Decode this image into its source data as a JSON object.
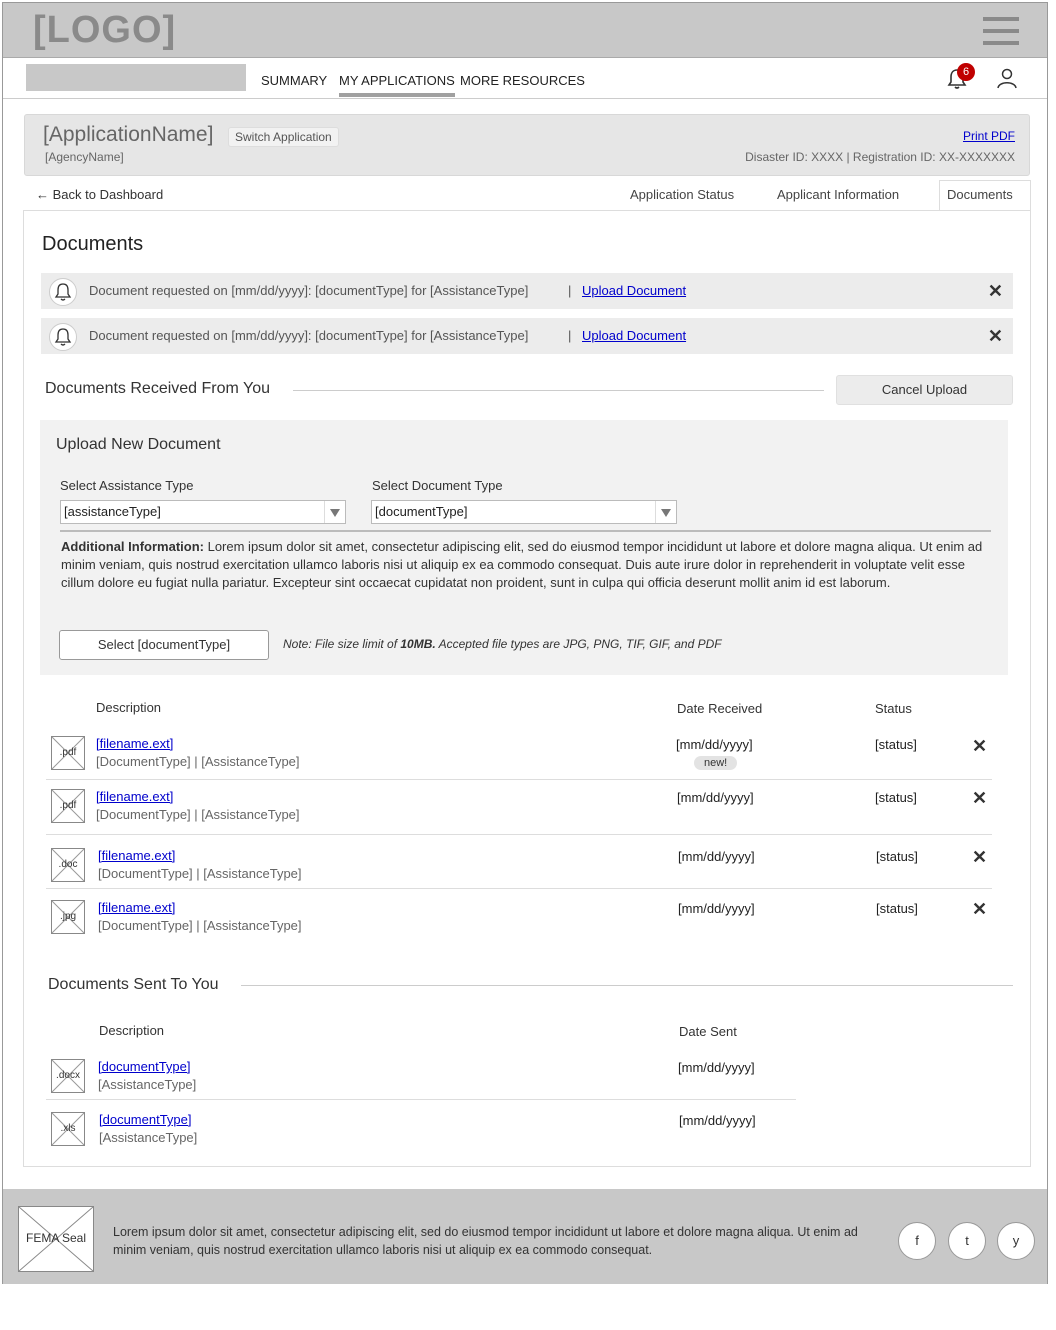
{
  "header": {
    "logo": "[LOGO]",
    "nav": [
      "SUMMARY",
      "MY APPLICATIONS",
      "MORE RESOURCES"
    ],
    "notification_count": "6"
  },
  "app": {
    "name": "[ApplicationName]",
    "switch_label": "Switch Application",
    "agency": "[AgencyName]",
    "print_label": "Print PDF",
    "ids": "Disaster ID: XXXX | Registration ID: XX-XXXXXXX"
  },
  "tabs": {
    "back": "← Back to Dashboard",
    "items": [
      "Application Status",
      "Applicant Information",
      "Documents"
    ],
    "active": "Documents"
  },
  "documents": {
    "title": "Documents",
    "notices": [
      {
        "text": "Document requested on [mm/dd/yyyy]: [documentType] for [AssistanceType]",
        "link": "Upload Document"
      },
      {
        "text": "Document requested on [mm/dd/yyyy]: [documentType] for [AssistanceType]",
        "link": "Upload Document"
      }
    ],
    "received_title": "Documents Received From You",
    "cancel_label": "Cancel Upload",
    "upload": {
      "title": "Upload New Document",
      "assistance_label": "Select Assistance Type",
      "assistance_value": "[assistanceType]",
      "doctype_label": "Select Document Type",
      "doctype_value": "[documentType]",
      "info_label": "Additional Information:",
      "info_text": " Lorem ipsum dolor sit amet, consectetur adipiscing elit, sed do eiusmod tempor incididunt ut labore et dolore magna aliqua. Ut enim ad minim veniam, quis nostrud exercitation ullamco laboris nisi ut aliquip ex ea commodo consequat. Duis aute irure dolor in reprehenderit in voluptate velit esse cillum dolore eu fugiat nulla pariatur. Excepteur sint occaecat cupidatat non proident, sunt in culpa qui officia deserunt mollit anim id est laborum.",
      "select_button": "Select [documentType]",
      "note_prefix": "Note: File size limit of ",
      "note_limit": "10MB.",
      "note_suffix": " Accepted file types are  JPG, PNG, TIF, GIF, and PDF"
    },
    "received_columns": [
      "Description",
      "Date Received",
      "Status"
    ],
    "received_rows": [
      {
        "ext": ".pdf",
        "name": "[filename.ext]",
        "meta": "[DocumentType] | [AssistanceType]",
        "date": "[mm/dd/yyyy]",
        "status": "[status]",
        "badge": "new!"
      },
      {
        "ext": ".pdf",
        "name": "[filename.ext]",
        "meta": "[DocumentType] | [AssistanceType]",
        "date": "[mm/dd/yyyy]",
        "status": "[status]"
      },
      {
        "ext": ".doc",
        "name": "[filename.ext]",
        "meta": "[DocumentType] | [AssistanceType]",
        "date": "[mm/dd/yyyy]",
        "status": "[status]"
      },
      {
        "ext": ".jpg",
        "name": "[filename.ext]",
        "meta": "[DocumentType] | [AssistanceType]",
        "date": "[mm/dd/yyyy]",
        "status": "[status]"
      }
    ],
    "sent_title": "Documents Sent To You",
    "sent_columns": [
      "Description",
      "Date Sent"
    ],
    "sent_rows": [
      {
        "ext": ".docx",
        "name": "[documentType]",
        "meta": "[AssistanceType]",
        "date": "[mm/dd/yyyy]"
      },
      {
        "ext": ".xls",
        "name": "[documentType]",
        "meta": "[AssistanceType]",
        "date": "[mm/dd/yyyy]"
      }
    ]
  },
  "footer": {
    "seal": "FEMA Seal",
    "text": "Lorem ipsum dolor sit amet, consectetur adipiscing elit, sed do eiusmod tempor incididunt ut labore et dolore magna aliqua. Ut enim ad minim veniam, quis nostrud exercitation ullamco laboris nisi ut aliquip ex ea commodo consequat.",
    "social": [
      "f",
      "t",
      "y"
    ]
  },
  "colors": {
    "link": "#0000cc",
    "badge": "#c00000",
    "chrome": "#c8c8c8"
  }
}
